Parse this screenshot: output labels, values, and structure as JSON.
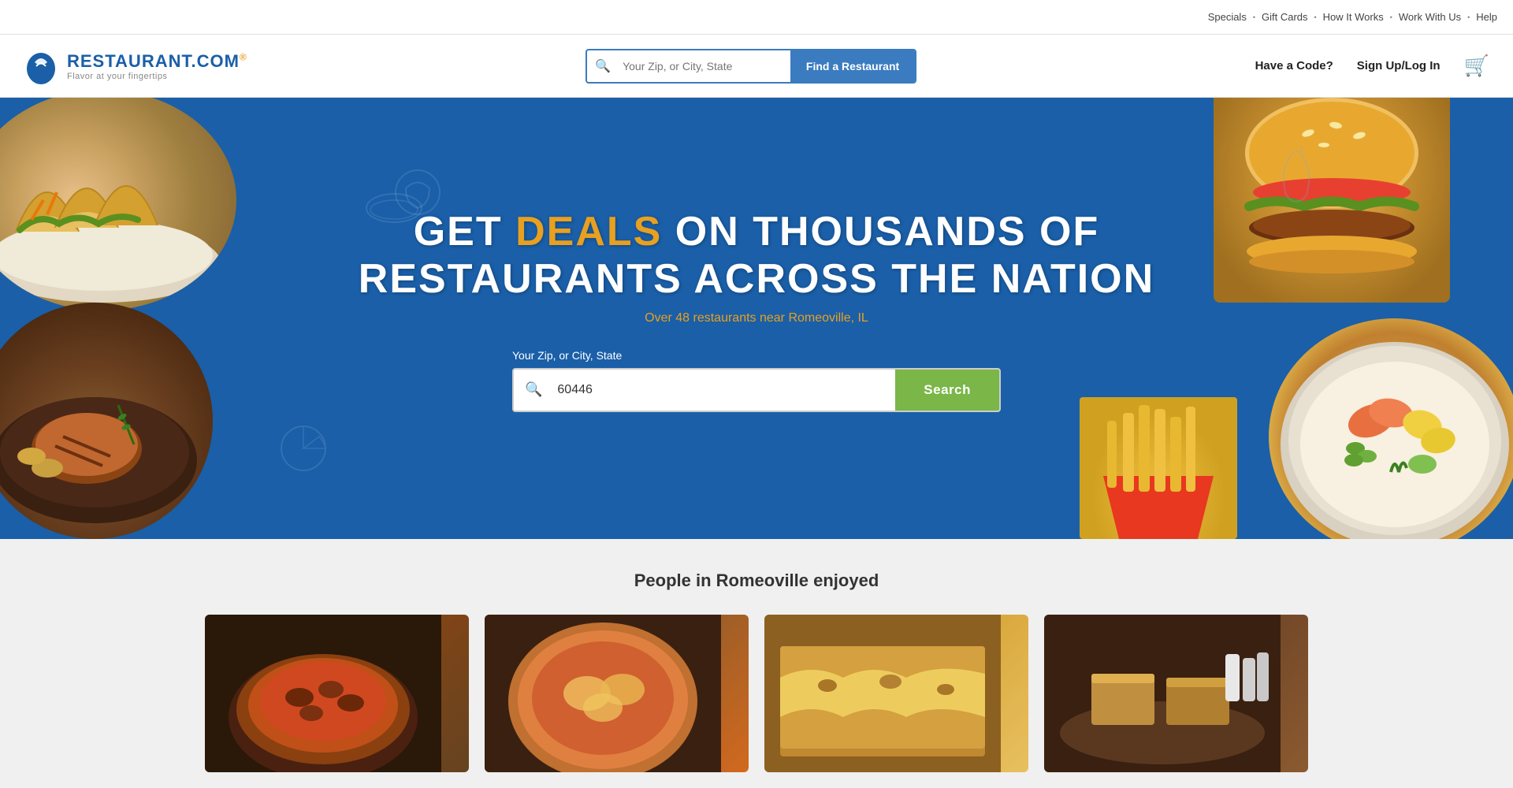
{
  "topnav": {
    "items": [
      {
        "label": "Specials",
        "id": "specials"
      },
      {
        "label": "Gift Cards",
        "id": "gift-cards"
      },
      {
        "label": "How It Works",
        "id": "how-it-works"
      },
      {
        "label": "Work With Us",
        "id": "work-with-us"
      },
      {
        "label": "Help",
        "id": "help"
      }
    ]
  },
  "header": {
    "logo": {
      "main": "RESTAURANT.COM",
      "trademark": "®",
      "sub": "Flavor at your fingertips"
    },
    "search": {
      "placeholder": "Your Zip, or City, State",
      "button_label": "Find a Restaurant"
    },
    "have_code": "Have a Code?",
    "sign_up": "Sign Up/Log In"
  },
  "hero": {
    "title_pre": "Get ",
    "title_deals": "Deals",
    "title_post": " on Thousands of\nRestaurants Across the Nation",
    "subtitle": "Over 48 restaurants near Romeoville, IL",
    "search_label": "Your Zip, or City, State",
    "search_value": "60446",
    "search_button": "Search"
  },
  "people_section": {
    "title": "People in Romeoville enjoyed"
  }
}
